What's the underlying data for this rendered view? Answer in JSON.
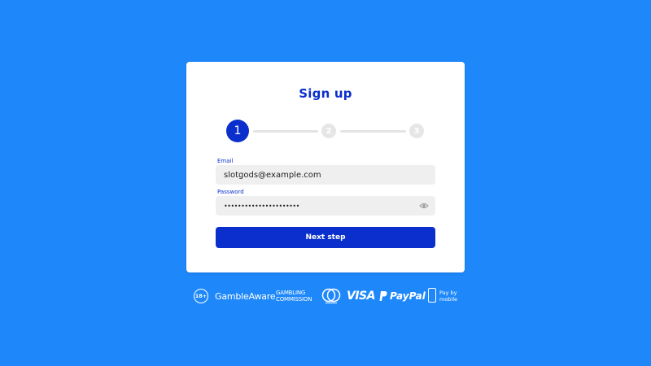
{
  "card": {
    "title": "Sign up"
  },
  "stepper": {
    "steps": [
      "1",
      "2",
      "3"
    ],
    "current": 1
  },
  "form": {
    "email_label": "Email",
    "email_value": "slotgods@example.com",
    "password_label": "Password",
    "password_value": "••••••••••••••••••••••",
    "submit_label": "Next step"
  },
  "footer": {
    "age": "18+",
    "gamble_aware": "GambleAware",
    "commission_line1": "GAMBLING",
    "commission_line2": "COMMISSION",
    "visa": "VISA",
    "paypal": "PayPal",
    "pay_by_line1": "Pay by",
    "pay_by_line2": "mobile"
  },
  "colors": {
    "background": "#1e88fb",
    "accent": "#0b2fcc",
    "input_bg": "#efefef",
    "step_inactive": "#e6e6e6"
  },
  "icons": [
    "cursor-icon",
    "eye-icon",
    "mastercard-icon",
    "paypal-icon",
    "mobile-icon"
  ]
}
